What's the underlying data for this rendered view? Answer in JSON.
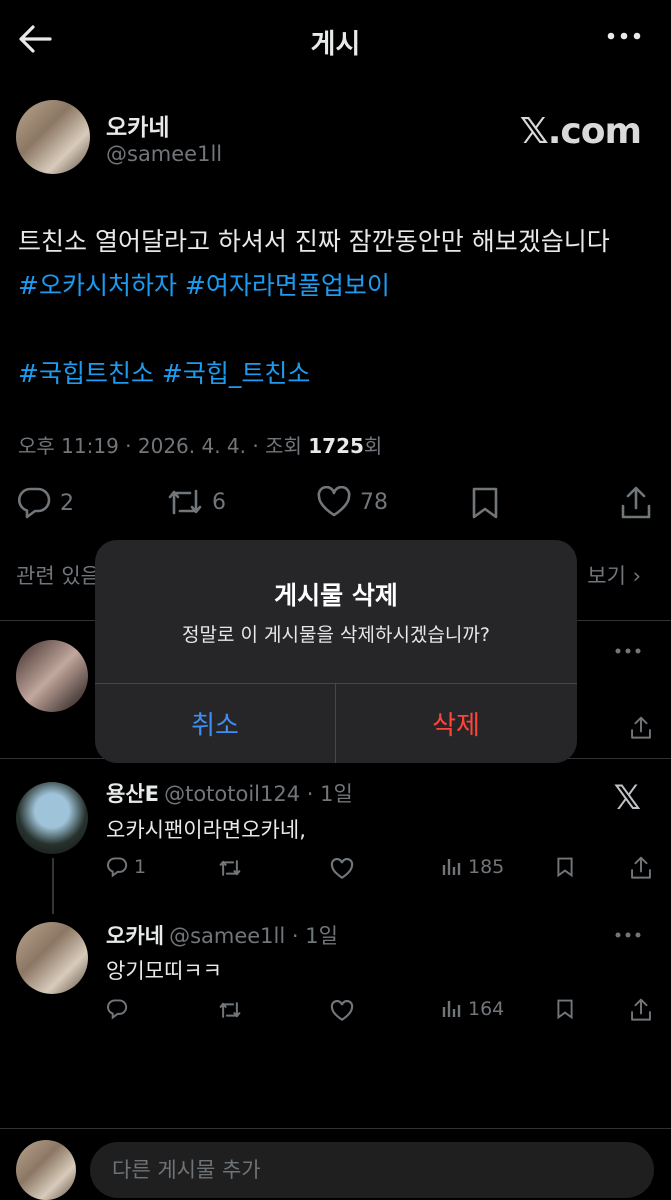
{
  "header": {
    "title": "게시",
    "back_icon": "arrow-left-icon",
    "more_icon": "more-horizontal-icon"
  },
  "post": {
    "author_name": "오카네",
    "author_handle": "@samee1ll",
    "watermark": "𝕏.com",
    "text_line1": "트친소 열어달라고 하셔서 진짜 잠깐동안만 해보겠습니다",
    "hashtags_line2": [
      "#오카시처하자",
      "#여자라면풀업보이"
    ],
    "hashtags_line4": [
      "#국힙트친소",
      "#국힙_트친소"
    ],
    "meta_prefix": "오후 11:19 · 2026. 4. 4. · 조회 ",
    "meta_views": "1725",
    "meta_suffix": "회",
    "actions": {
      "replies": "2",
      "reposts": "6",
      "likes": "78"
    }
  },
  "related": {
    "left": "관련 있음",
    "right": "보기"
  },
  "replies": [
    {
      "name": "용산E",
      "handle": "@tototoil124 · 1일",
      "text": "오카시팬이라면오카네,",
      "reply_count": "1",
      "views": "185"
    },
    {
      "name": "오카네",
      "handle": "@samee1ll · 1일",
      "text": "앙기모띠ㅋㅋ",
      "views": "164"
    }
  ],
  "dialog": {
    "title": "게시물 삭제",
    "message": "정말로 이 게시물을 삭제하시겠습니까?",
    "cancel_label": "취소",
    "delete_label": "삭제"
  },
  "composer": {
    "placeholder": "다른 게시물 추가"
  },
  "colors": {
    "accent": "#1d9bf0",
    "destructive": "#ff453a",
    "dialog_action": "#3d8ff5"
  }
}
